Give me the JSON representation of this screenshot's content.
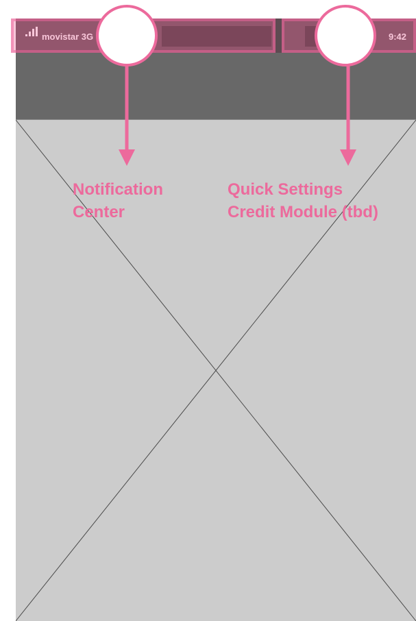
{
  "status_bar": {
    "carrier": "movistar 3G",
    "time": "9:42"
  },
  "icons": {
    "signal": "signal-strength-icon"
  },
  "annotations": {
    "left": {
      "line1": "Notification",
      "line2": "Center"
    },
    "right": {
      "line1": "Quick Settings",
      "line2": "Credit Module (tbd)"
    }
  },
  "colors": {
    "annotation": "#ec6a9c",
    "status_bar": "#5d4b52",
    "header": "#686868",
    "content": "#cccccc"
  }
}
